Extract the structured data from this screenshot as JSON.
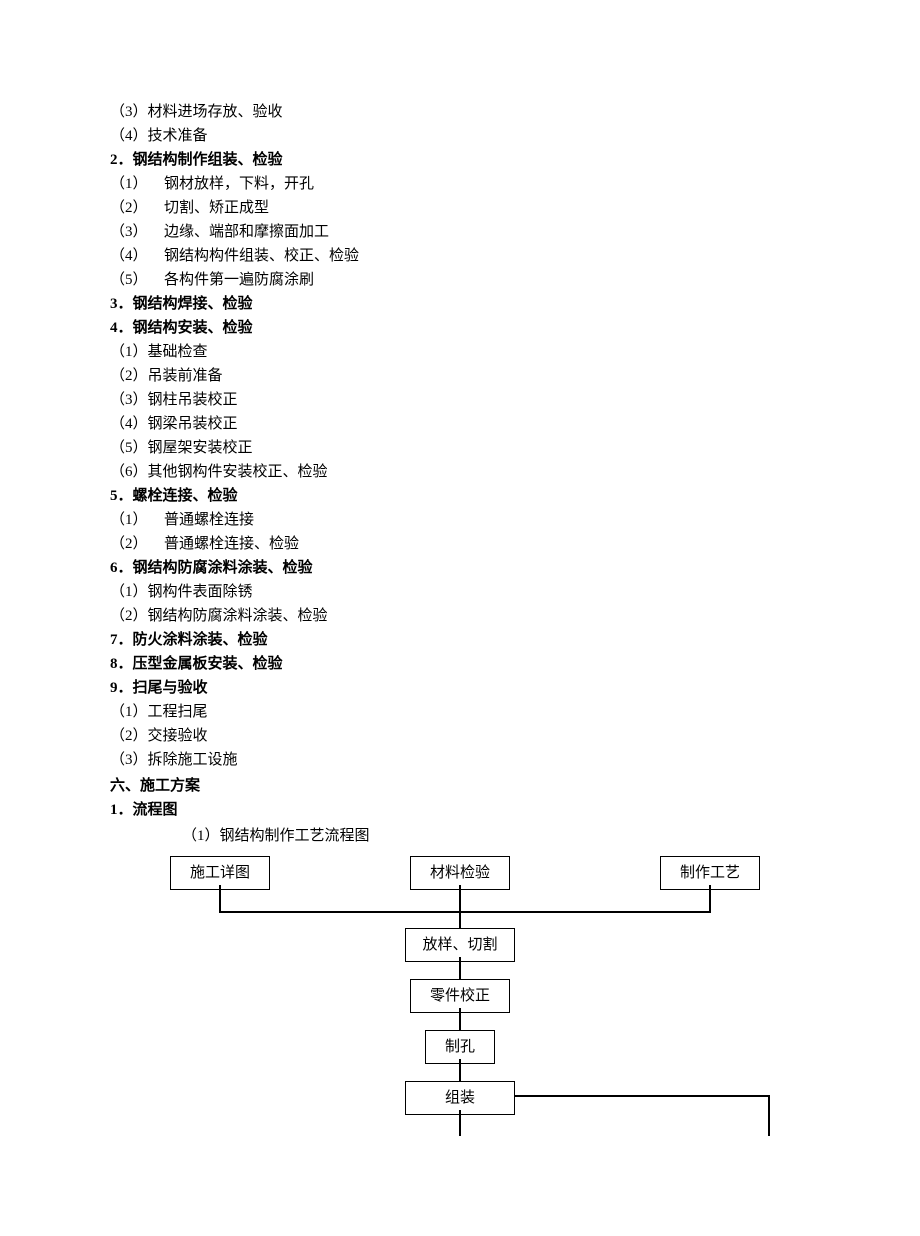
{
  "pre_items": [
    "（3）材料进场存放、验收",
    "（4）技术准备"
  ],
  "h2": "2．钢结构制作组装、检验",
  "h2_items": [
    {
      "label": "（1）",
      "text": "钢材放样，下料，开孔"
    },
    {
      "label": "（2）",
      "text": "切割、矫正成型"
    },
    {
      "label": "（3）",
      "text": "边缘、端部和摩擦面加工"
    },
    {
      "label": "（4）",
      "text": "钢结构构件组装、校正、检验"
    },
    {
      "label": "（5）",
      "text": "各构件第一遍防腐涂刷"
    }
  ],
  "h3": "3．钢结构焊接、检验",
  "h4": "4．钢结构安装、检验",
  "h4_items": [
    "（1）基础检查",
    "（2）吊装前准备",
    "（3）钢柱吊装校正",
    "（4）钢梁吊装校正",
    "（5）钢屋架安装校正",
    "（6）其他钢构件安装校正、检验"
  ],
  "h5": "5．螺栓连接、检验",
  "h5_items": [
    {
      "label": "（1）",
      "text": "普通螺栓连接"
    },
    {
      "label": "（2）",
      "text": "普通螺栓连接、检验"
    }
  ],
  "h6": "6．钢结构防腐涂料涂装、检验",
  "h6_items": [
    "（1）钢构件表面除锈",
    "（2）钢结构防腐涂料涂装、检验"
  ],
  "h7": "7．防火涂料涂装、检验",
  "h8": "8．压型金属板安装、检验",
  "h9": "9．扫尾与验收",
  "h9_items": [
    "（1）工程扫尾",
    "（2）交接验收",
    "（3）拆除施工设施"
  ],
  "sec6": "六、施工方案",
  "sec6_1": "1．流程图",
  "flow_title": "（1）钢结构制作工艺流程图",
  "chart_data": {
    "type": "flowchart",
    "top_row": [
      "施工详图",
      "材料检验",
      "制作工艺"
    ],
    "sequence": [
      "放样、切割",
      "零件校正",
      "制孔",
      "组装"
    ],
    "edges_top_merge_into": "放样、切割",
    "right_feedback_from": "组装"
  }
}
